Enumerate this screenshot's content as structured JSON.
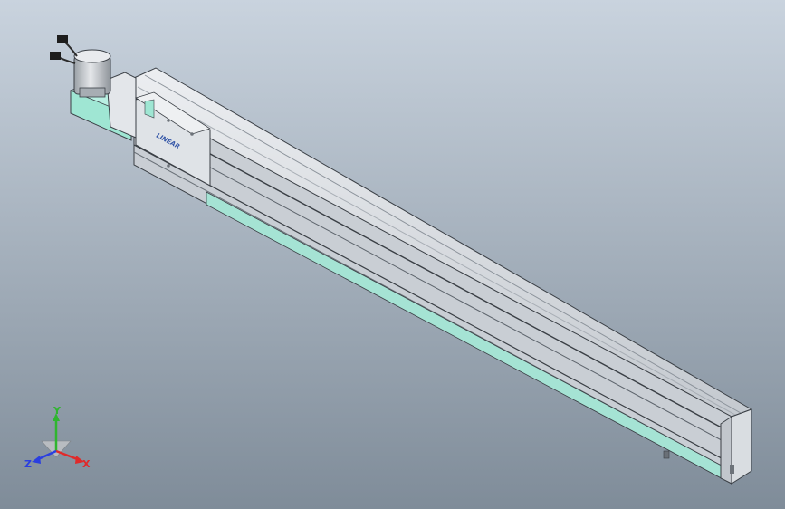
{
  "viewport": {
    "background_top": "#c9d3de",
    "background_bottom": "#7f8c99"
  },
  "model": {
    "icon": "linear-actuator-3d-model",
    "rail_body_color": "#d2d6dc",
    "rail_top_color": "#e7e9ec",
    "bracket_color": "#9fe6d3",
    "motor_color": "#c4c8cc",
    "carriage_color": "#dfe3e7",
    "carriage_logo_text": "LINEAR",
    "carriage_logo_color": "#3557a8"
  },
  "triad": {
    "icon": "coordinate-triad-icon",
    "x_label": "X",
    "y_label": "Y",
    "z_label": "Z",
    "x_color": "#e02a2a",
    "y_color": "#2fb52f",
    "z_color": "#2a3fe0"
  }
}
